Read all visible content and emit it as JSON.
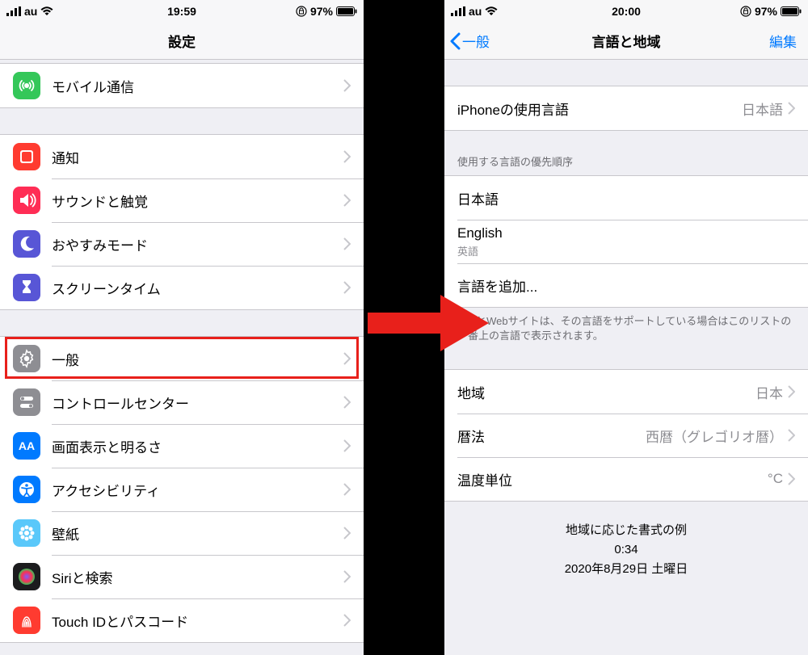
{
  "left": {
    "status": {
      "carrier": "au",
      "time": "19:59",
      "battery": "97%"
    },
    "title": "設定",
    "groups": [
      [
        {
          "icon": "antenna",
          "color": "#34c759",
          "label": "モバイル通信"
        }
      ],
      [
        {
          "icon": "bell",
          "color": "#ff3b30",
          "label": "通知"
        },
        {
          "icon": "sound",
          "color": "#ff2d55",
          "label": "サウンドと触覚"
        },
        {
          "icon": "moon",
          "color": "#5856d6",
          "label": "おやすみモード"
        },
        {
          "icon": "hour",
          "color": "#5856d6",
          "label": "スクリーンタイム"
        }
      ],
      [
        {
          "icon": "gear",
          "color": "#8e8e93",
          "label": "一般",
          "highlight": true
        },
        {
          "icon": "toggles",
          "color": "#8e8e93",
          "label": "コントロールセンター"
        },
        {
          "icon": "aa",
          "color": "#007aff",
          "label": "画面表示と明るさ"
        },
        {
          "icon": "access",
          "color": "#007aff",
          "label": "アクセシビリティ"
        },
        {
          "icon": "flower",
          "color": "#5ac8fa",
          "label": "壁紙"
        },
        {
          "icon": "siri",
          "color": "#1c1c1e",
          "label": "Siriと検索"
        },
        {
          "icon": "finger",
          "color": "#ff3b30",
          "label": "Touch IDとパスコード"
        }
      ]
    ]
  },
  "right": {
    "status": {
      "carrier": "au",
      "time": "20:00",
      "battery": "97%"
    },
    "back": "一般",
    "title": "言語と地域",
    "edit": "編集",
    "iphone_lang_label": "iPhoneの使用言語",
    "iphone_lang_value": "日本語",
    "pref_header": "使用する言語の優先順序",
    "langs": [
      {
        "label": "日本語"
      },
      {
        "label": "English",
        "sub": "英語"
      }
    ],
    "add_lang": "言語を追加...",
    "pref_footer": "AppとWebサイトは、その言語をサポートしている場合はこのリストの一番上の言語で表示されます。",
    "region_rows": [
      {
        "label": "地域",
        "value": "日本"
      },
      {
        "label": "暦法",
        "value": "西暦（グレゴリオ暦）"
      },
      {
        "label": "温度単位",
        "value": "°C"
      }
    ],
    "example_title": "地域に応じた書式の例",
    "example_time": "0:34",
    "example_date": "2020年8月29日 土曜日"
  }
}
